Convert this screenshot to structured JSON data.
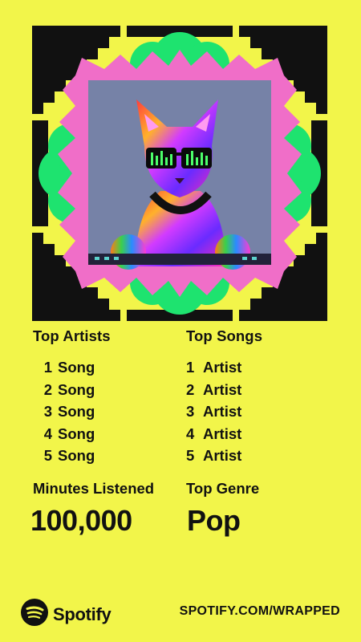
{
  "top_artists": {
    "title": "Top Artists",
    "items": [
      {
        "rank": "1",
        "name": "Song"
      },
      {
        "rank": "2",
        "name": "Song"
      },
      {
        "rank": "3",
        "name": "Song"
      },
      {
        "rank": "4",
        "name": "Song"
      },
      {
        "rank": "5",
        "name": "Song"
      }
    ]
  },
  "top_songs": {
    "title": "Top Songs",
    "items": [
      {
        "rank": "1",
        "name": "Artist"
      },
      {
        "rank": "2",
        "name": "Artist"
      },
      {
        "rank": "3",
        "name": "Artist"
      },
      {
        "rank": "4",
        "name": "Artist"
      },
      {
        "rank": "5",
        "name": "Artist"
      }
    ]
  },
  "minutes": {
    "label": "Minutes Listened",
    "value": "100,000"
  },
  "genre": {
    "label": "Top Genre",
    "value": "Pop"
  },
  "footer": {
    "brand": "Spotify",
    "url": "SPOTIFY.COM/WRAPPED"
  },
  "colors": {
    "background": "#f2f54a",
    "frame_black": "#111111",
    "frame_pink": "#f06ec8",
    "frame_green": "#1ee36f",
    "text": "#111111"
  },
  "icons": {
    "album_art": "dj-cat-image",
    "logo": "spotify-logo-icon"
  }
}
